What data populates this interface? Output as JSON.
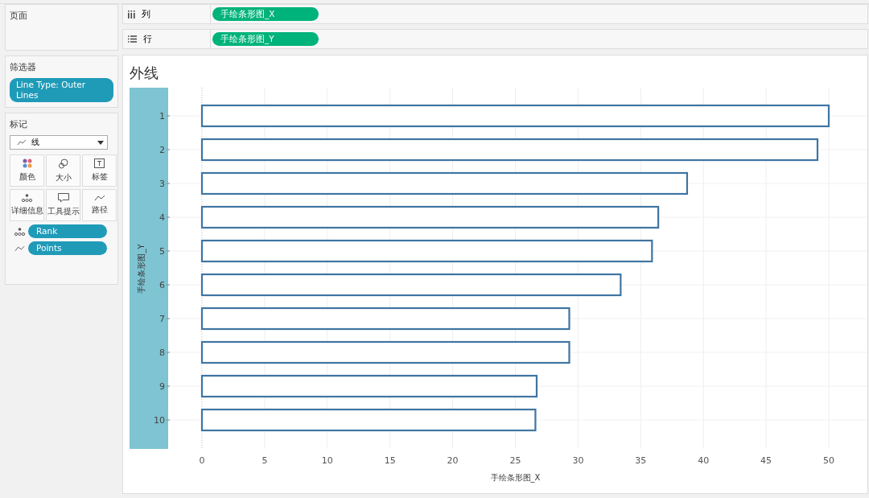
{
  "pages_card": {
    "title": "页面"
  },
  "shelves": [
    {
      "kind": "columns",
      "label": "列",
      "pills": [
        "手绘条形图_X"
      ]
    },
    {
      "kind": "rows",
      "label": "行",
      "pills": [
        "手绘条形图_Y"
      ]
    }
  ],
  "filters_card": {
    "title": "筛选器",
    "pills": [
      "Line Type: Outer Lines"
    ]
  },
  "marks_card": {
    "title": "标记",
    "mark_type": {
      "kind": "line",
      "label": "线"
    },
    "buttons": [
      {
        "kind": "color",
        "label": "颜色"
      },
      {
        "kind": "size",
        "label": "大小"
      },
      {
        "kind": "label",
        "label": "标签"
      },
      {
        "kind": "detail",
        "label": "详细信息"
      },
      {
        "kind": "tooltip",
        "label": "工具提示"
      },
      {
        "kind": "path",
        "label": "路径"
      }
    ],
    "fields": [
      {
        "kind": "detail",
        "label": "Rank"
      },
      {
        "kind": "path",
        "label": "Points"
      }
    ]
  },
  "chart": {
    "title": "外线",
    "chart_data": {
      "type": "bar",
      "orientation": "horizontal",
      "xlabel": "手绘条形图_X",
      "ylabel": "手绘条形图_Y",
      "categories": [
        "1",
        "2",
        "3",
        "4",
        "5",
        "6",
        "7",
        "8",
        "9",
        "10"
      ],
      "grid": true,
      "series": [
        {
          "color": "#3f75a2",
          "values": [
            50.0,
            49.1,
            38.7,
            36.4,
            35.9,
            33.4,
            29.3,
            29.3,
            26.7,
            26.6
          ]
        }
      ],
      "xlim": [
        0,
        50
      ],
      "xticks": [
        0,
        5,
        10,
        15,
        20,
        25,
        30,
        35,
        40,
        45,
        50
      ]
    }
  }
}
